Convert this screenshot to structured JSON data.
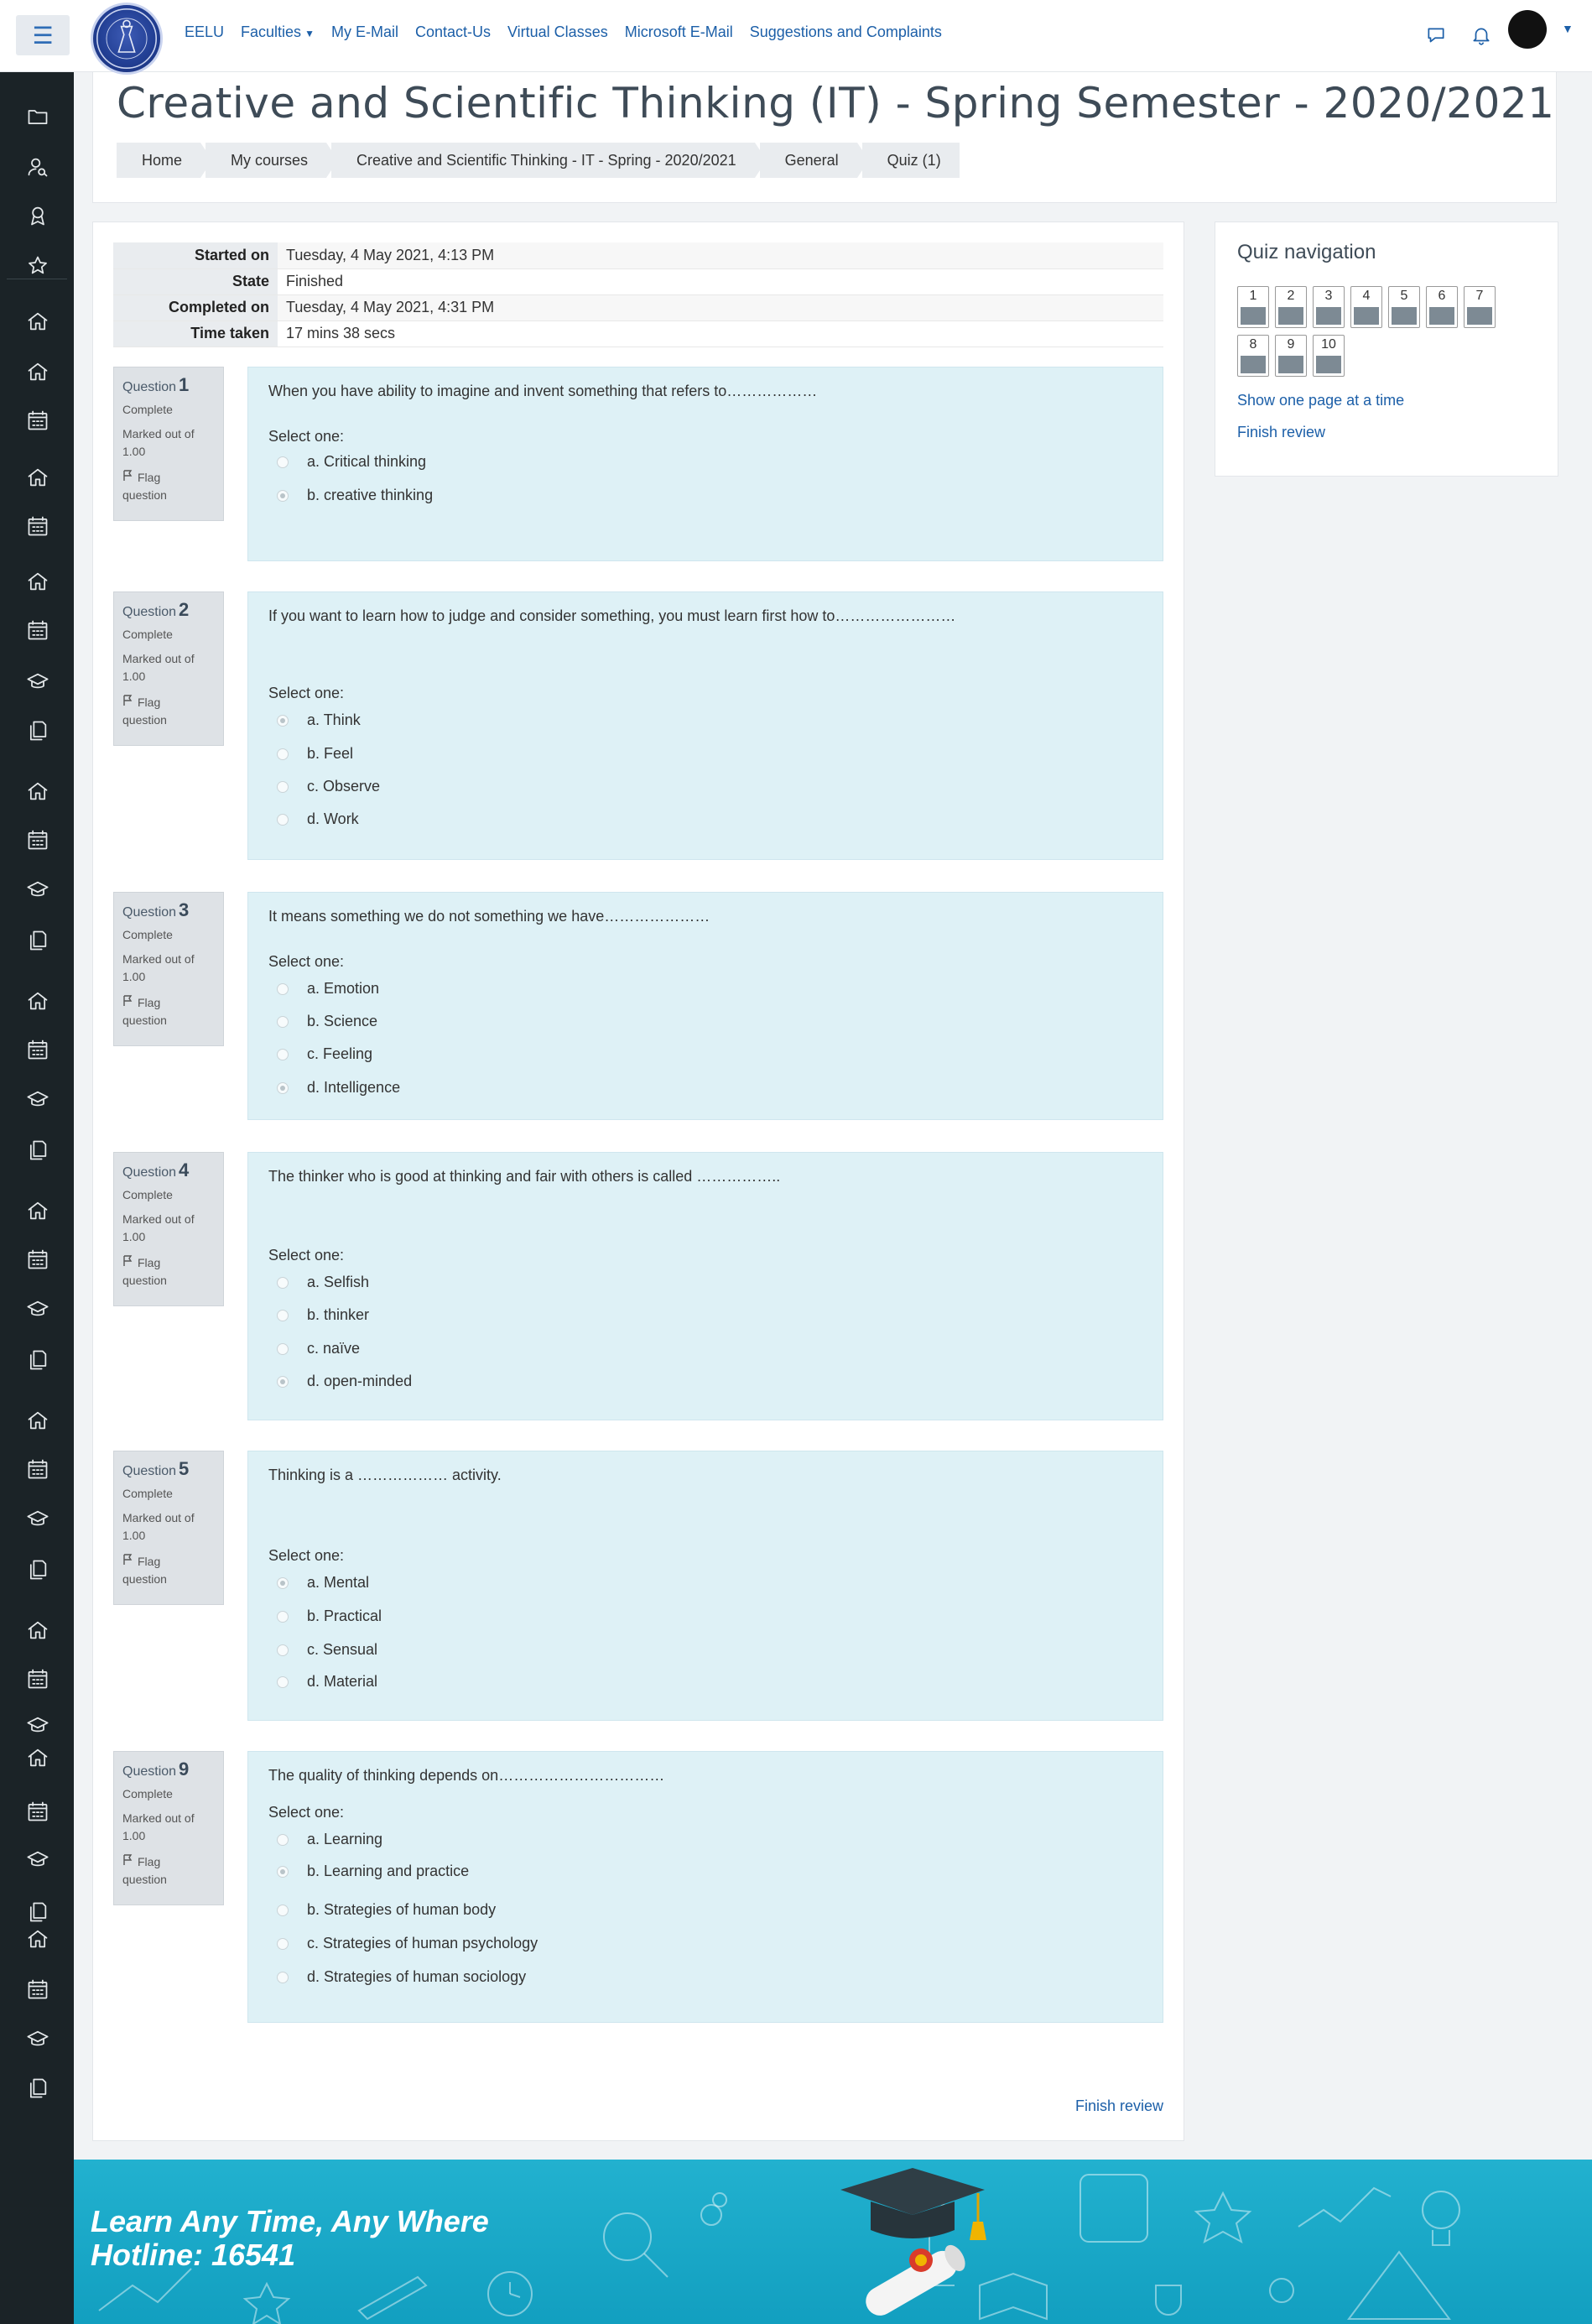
{
  "topbar": {
    "nav": [
      {
        "label": "EELU",
        "dropdown": false
      },
      {
        "label": "Faculties",
        "dropdown": true
      },
      {
        "label": "My E-Mail",
        "dropdown": false
      },
      {
        "label": "Contact-Us",
        "dropdown": false
      },
      {
        "label": "Virtual Classes",
        "dropdown": false
      },
      {
        "label": "Microsoft E-Mail",
        "dropdown": false
      },
      {
        "label": "Suggestions and Complaints",
        "dropdown": false
      }
    ],
    "icons": [
      "menu-icon",
      "message-icon",
      "bell-icon",
      "avatar",
      "chevron-down-icon"
    ]
  },
  "header": {
    "title": "Creative and Scientific Thinking (IT) - Spring Semester - 2020/2021",
    "breadcrumb": [
      "Home",
      "My courses",
      "Creative and Scientific Thinking - IT - Spring - 2020/2021",
      "General",
      "Quiz (1)"
    ]
  },
  "summary": [
    {
      "label": "Started on",
      "value": "Tuesday, 4 May 2021, 4:13 PM"
    },
    {
      "label": "State",
      "value": "Finished"
    },
    {
      "label": "Completed on",
      "value": "Tuesday, 4 May 2021, 4:31 PM"
    },
    {
      "label": "Time taken",
      "value": "17 mins 38 secs"
    }
  ],
  "question_meta": {
    "word": "Question",
    "state": "Complete",
    "marked_line1": "Marked out of",
    "marked_line2": "1.00",
    "flag_line1": "Flag",
    "flag_line2": "question",
    "prompt": "Select one:"
  },
  "questions": [
    {
      "number": "1",
      "text": "When you have ability to imagine and invent something that refers to………………",
      "options": [
        {
          "label": "a. Critical thinking",
          "selected": false
        },
        {
          "label": "b. creative thinking",
          "selected": true
        }
      ]
    },
    {
      "number": "2",
      "text": "If you want to learn how to judge and consider something, you must learn first how to……………………",
      "options": [
        {
          "label": "a. Think",
          "selected": true
        },
        {
          "label": "b. Feel",
          "selected": false
        },
        {
          "label": "c. Observe",
          "selected": false
        },
        {
          "label": "d. Work",
          "selected": false
        }
      ]
    },
    {
      "number": "3",
      "text": "It means something we do not something we have…………………",
      "options": [
        {
          "label": "a. Emotion",
          "selected": false
        },
        {
          "label": "b. Science",
          "selected": false
        },
        {
          "label": "c. Feeling",
          "selected": false
        },
        {
          "label": "d. Intelligence",
          "selected": true
        }
      ]
    },
    {
      "number": "4",
      "text": "The thinker who is good at thinking and fair with others is called ……………..",
      "options": [
        {
          "label": "a. Selfish",
          "selected": false
        },
        {
          "label": "b. thinker",
          "selected": false
        },
        {
          "label": "c. naïve",
          "selected": false
        },
        {
          "label": "d. open-minded",
          "selected": true
        }
      ]
    },
    {
      "number": "5",
      "text": "Thinking is a ……………… activity.",
      "options": [
        {
          "label": "a. Mental",
          "selected": true
        },
        {
          "label": "b. Practical",
          "selected": false
        },
        {
          "label": "c. Sensual",
          "selected": false
        },
        {
          "label": "d. Material",
          "selected": false
        }
      ]
    },
    {
      "number": "9",
      "text": "The quality of thinking depends on……………………………",
      "options": [
        {
          "label": "a. Learning",
          "selected": false
        },
        {
          "label": "b. Learning and practice",
          "selected": true
        },
        {
          "label": "b. Strategies of human body",
          "selected": false
        },
        {
          "label": "c. Strategies of human psychology",
          "selected": false
        },
        {
          "label": "d. Strategies of human sociology",
          "selected": false
        }
      ]
    }
  ],
  "quiz_nav": {
    "title": "Quiz navigation",
    "buttons": [
      "1",
      "2",
      "3",
      "4",
      "5",
      "6",
      "7",
      "8",
      "9",
      "10"
    ],
    "show_one_page": "Show one page at a time",
    "finish_review": "Finish review"
  },
  "finish_review_bottom": "Finish review",
  "footer": {
    "line1": "Learn Any Time, Any Where",
    "line2": "Hotline: 16541"
  },
  "sidebar_icons": [
    "folder-icon",
    "user-search-icon",
    "badge-icon",
    "star-icon",
    "home-icon",
    "home-icon",
    "calendar-icon",
    "home-icon",
    "calendar-icon",
    "home-icon",
    "calendar-icon",
    "graduation-cap-icon",
    "files-icon",
    "home-icon",
    "calendar-icon",
    "graduation-cap-icon",
    "files-icon",
    "home-icon",
    "calendar-icon",
    "graduation-cap-icon",
    "files-icon",
    "home-icon",
    "calendar-icon",
    "graduation-cap-icon",
    "files-icon",
    "home-icon",
    "calendar-icon",
    "graduation-cap-icon",
    "files-icon",
    "home-icon",
    "calendar-icon",
    "graduation-cap-icon",
    "home-icon",
    "calendar-icon",
    "graduation-cap-icon",
    "files-icon",
    "home-icon",
    "calendar-icon",
    "graduation-cap-icon",
    "files-icon"
  ],
  "colors": {
    "link": "#1c5fa8",
    "sidebar": "#1b2327",
    "question_bg": "#def1f6",
    "info_bg": "#dee2e6",
    "footer": "#1aa9c9"
  }
}
